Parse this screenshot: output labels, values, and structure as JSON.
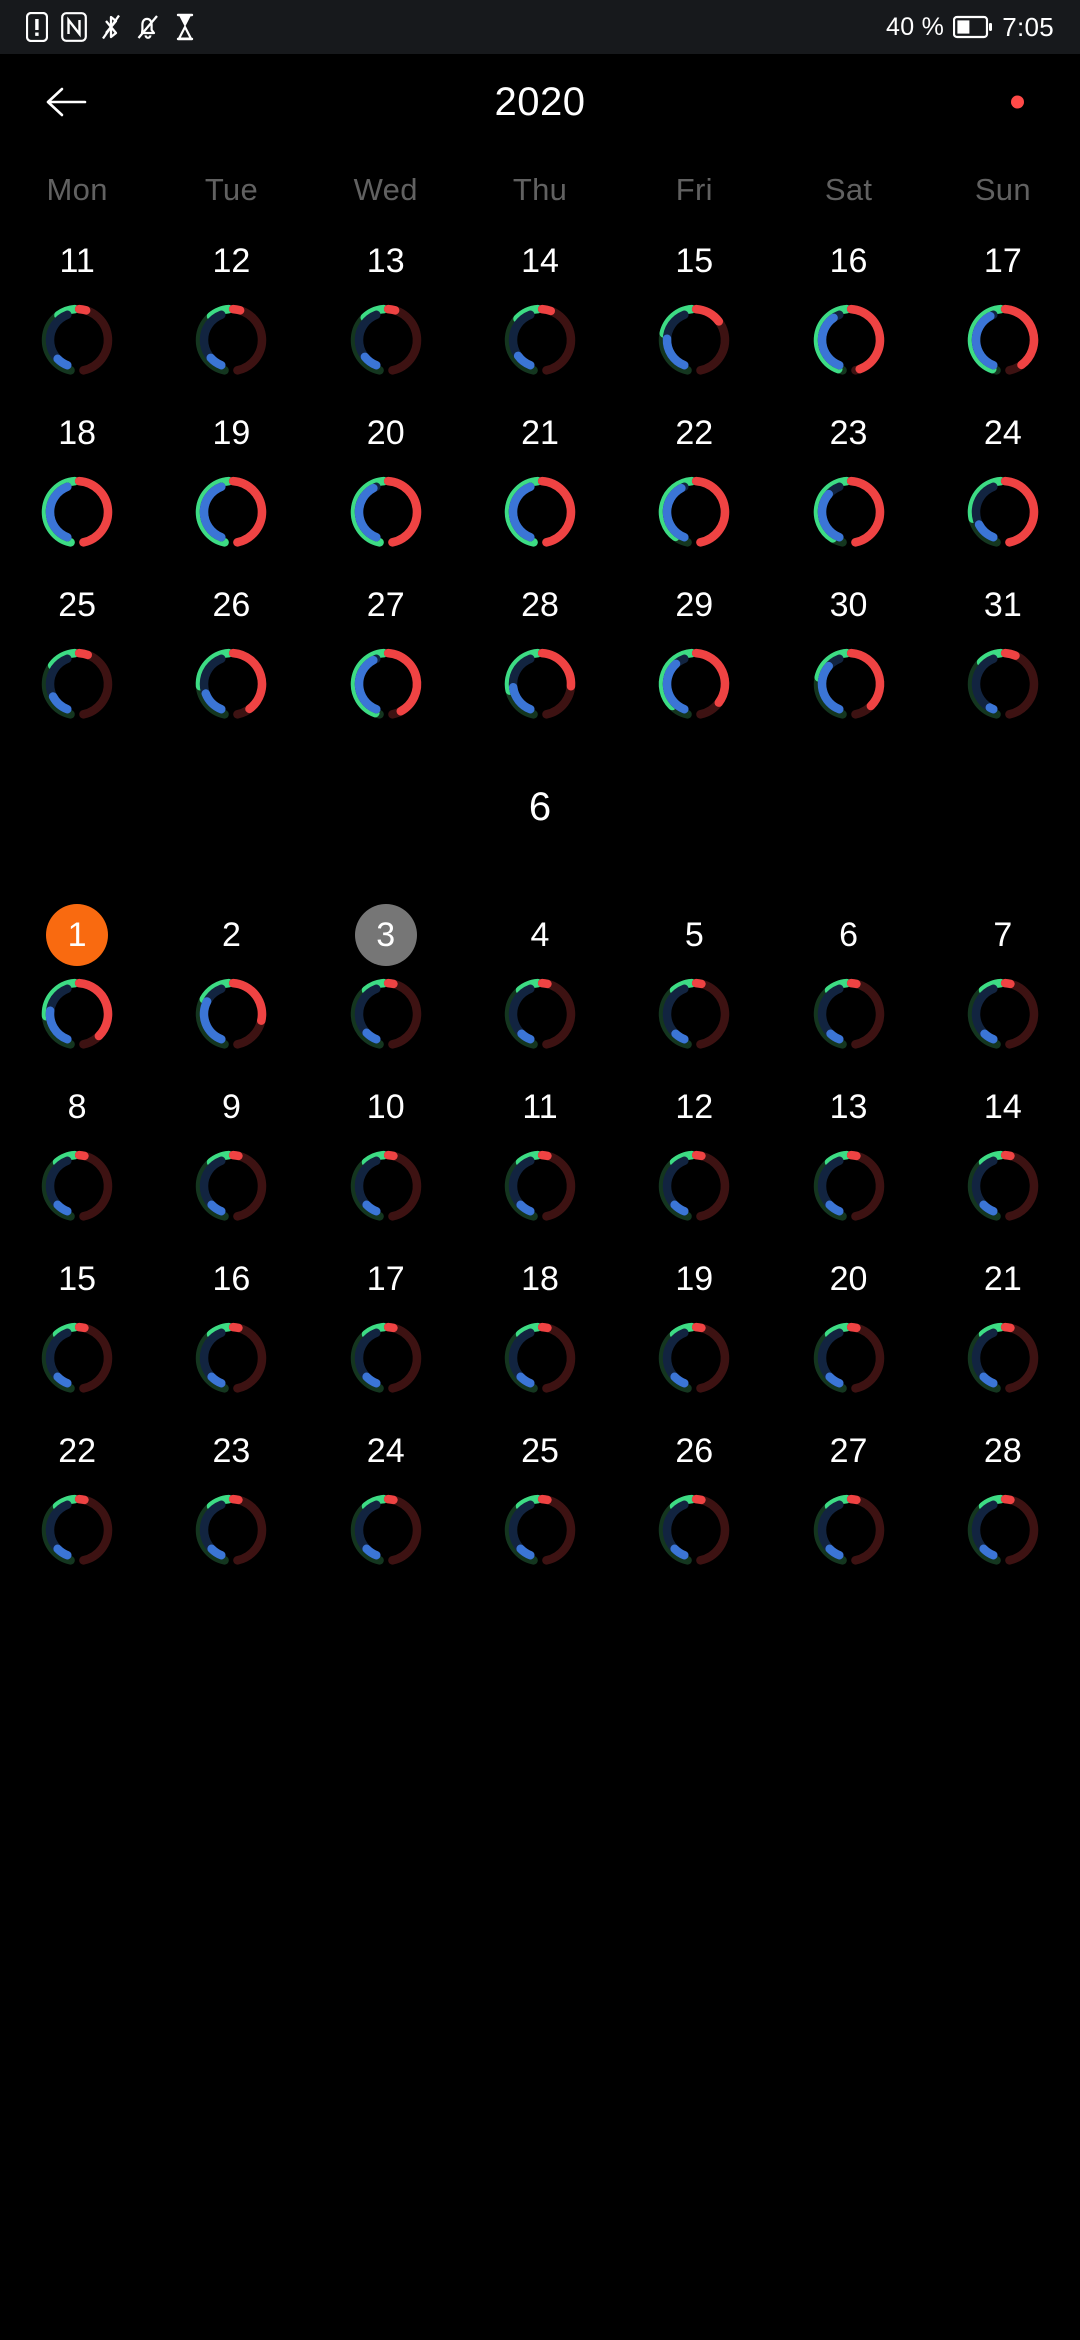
{
  "status_bar": {
    "icons": [
      "sim-alert-icon",
      "nfc-icon",
      "bluetooth-off-icon",
      "notifications-muted-icon",
      "hourglass-icon"
    ],
    "battery_percent": "40 %",
    "battery_icon": "battery-half-icon",
    "time": "7:05"
  },
  "app_bar": {
    "back_icon": "back-arrow-icon",
    "title": "2020",
    "indicator_icon": "red-dot-icon",
    "indicator_color": "#ff4a48"
  },
  "weekdays": [
    "Mon",
    "Tue",
    "Wed",
    "Thu",
    "Fri",
    "Sat",
    "Sun"
  ],
  "ring_colors": {
    "green_fill": "#3ddc84",
    "green_track": "#14361f",
    "red_fill": "#ef4343",
    "red_track": "#3d1212",
    "blue_fill": "#3b75d6",
    "blue_track": "#122440"
  },
  "highlight_colors": {
    "today": "#f96a10",
    "selected": "#767676"
  },
  "month_separator": "6",
  "weeks": [
    {
      "days": [
        {
          "label": "11",
          "green": 0.2,
          "red": 0.08,
          "blue": 0.18,
          "state": "none"
        },
        {
          "label": "12",
          "green": 0.22,
          "red": 0.08,
          "blue": 0.2,
          "state": "none"
        },
        {
          "label": "13",
          "green": 0.24,
          "red": 0.08,
          "blue": 0.22,
          "state": "none"
        },
        {
          "label": "14",
          "green": 0.26,
          "red": 0.1,
          "blue": 0.24,
          "state": "none"
        },
        {
          "label": "15",
          "green": 0.45,
          "red": 0.3,
          "blue": 0.52,
          "state": "none"
        },
        {
          "label": "16",
          "green": 0.95,
          "red": 0.95,
          "blue": 0.9,
          "state": "none"
        },
        {
          "label": "17",
          "green": 0.95,
          "red": 0.85,
          "blue": 0.95,
          "state": "none"
        }
      ]
    },
    {
      "days": [
        {
          "label": "18",
          "green": 1.0,
          "red": 1.0,
          "blue": 1.0,
          "state": "none"
        },
        {
          "label": "19",
          "green": 1.0,
          "red": 1.0,
          "blue": 1.0,
          "state": "none"
        },
        {
          "label": "20",
          "green": 1.0,
          "red": 1.0,
          "blue": 0.95,
          "state": "none"
        },
        {
          "label": "21",
          "green": 1.0,
          "red": 1.0,
          "blue": 1.0,
          "state": "none"
        },
        {
          "label": "22",
          "green": 0.85,
          "red": 1.0,
          "blue": 0.95,
          "state": "none"
        },
        {
          "label": "23",
          "green": 0.88,
          "red": 1.0,
          "blue": 0.8,
          "state": "none"
        },
        {
          "label": "24",
          "green": 0.6,
          "red": 1.0,
          "blue": 0.3,
          "state": "none"
        }
      ]
    },
    {
      "days": [
        {
          "label": "25",
          "green": 0.3,
          "red": 0.1,
          "blue": 0.3,
          "state": "none"
        },
        {
          "label": "26",
          "green": 0.55,
          "red": 0.85,
          "blue": 0.35,
          "state": "none"
        },
        {
          "label": "27",
          "green": 0.95,
          "red": 0.9,
          "blue": 0.95,
          "state": "none"
        },
        {
          "label": "28",
          "green": 0.6,
          "red": 0.55,
          "blue": 0.45,
          "state": "none"
        },
        {
          "label": "29",
          "green": 0.8,
          "red": 0.75,
          "blue": 0.85,
          "state": "none"
        },
        {
          "label": "30",
          "green": 0.45,
          "red": 0.8,
          "blue": 0.8,
          "state": "none"
        },
        {
          "label": "31",
          "green": 0.25,
          "red": 0.12,
          "blue": 0.05,
          "state": "none"
        }
      ]
    }
  ],
  "weeks2": [
    {
      "days": [
        {
          "label": "1",
          "green": 0.55,
          "red": 0.8,
          "blue": 0.55,
          "state": "today"
        },
        {
          "label": "2",
          "green": 0.35,
          "red": 0.6,
          "blue": 0.7,
          "state": "none"
        },
        {
          "label": "3",
          "green": 0.22,
          "red": 0.06,
          "blue": 0.18,
          "state": "selected"
        },
        {
          "label": "4",
          "green": 0.22,
          "red": 0.06,
          "blue": 0.16,
          "state": "none"
        },
        {
          "label": "5",
          "green": 0.22,
          "red": 0.06,
          "blue": 0.16,
          "state": "none"
        },
        {
          "label": "6",
          "green": 0.22,
          "red": 0.06,
          "blue": 0.16,
          "state": "none"
        },
        {
          "label": "7",
          "green": 0.22,
          "red": 0.06,
          "blue": 0.16,
          "state": "none"
        }
      ]
    },
    {
      "days": [
        {
          "label": "8",
          "green": 0.22,
          "red": 0.06,
          "blue": 0.18,
          "state": "none"
        },
        {
          "label": "9",
          "green": 0.22,
          "red": 0.06,
          "blue": 0.18,
          "state": "none"
        },
        {
          "label": "10",
          "green": 0.22,
          "red": 0.06,
          "blue": 0.18,
          "state": "none"
        },
        {
          "label": "11",
          "green": 0.22,
          "red": 0.06,
          "blue": 0.18,
          "state": "none"
        },
        {
          "label": "12",
          "green": 0.22,
          "red": 0.06,
          "blue": 0.18,
          "state": "none"
        },
        {
          "label": "13",
          "green": 0.22,
          "red": 0.06,
          "blue": 0.18,
          "state": "none"
        },
        {
          "label": "14",
          "green": 0.22,
          "red": 0.06,
          "blue": 0.18,
          "state": "none"
        }
      ]
    },
    {
      "days": [
        {
          "label": "15",
          "green": 0.22,
          "red": 0.06,
          "blue": 0.18,
          "state": "none"
        },
        {
          "label": "16",
          "green": 0.22,
          "red": 0.06,
          "blue": 0.18,
          "state": "none"
        },
        {
          "label": "17",
          "green": 0.22,
          "red": 0.06,
          "blue": 0.18,
          "state": "none"
        },
        {
          "label": "18",
          "green": 0.22,
          "red": 0.06,
          "blue": 0.18,
          "state": "none"
        },
        {
          "label": "19",
          "green": 0.22,
          "red": 0.06,
          "blue": 0.18,
          "state": "none"
        },
        {
          "label": "20",
          "green": 0.22,
          "red": 0.06,
          "blue": 0.18,
          "state": "none"
        },
        {
          "label": "21",
          "green": 0.22,
          "red": 0.06,
          "blue": 0.18,
          "state": "none"
        }
      ]
    },
    {
      "days": [
        {
          "label": "22",
          "green": 0.22,
          "red": 0.06,
          "blue": 0.18,
          "state": "none"
        },
        {
          "label": "23",
          "green": 0.22,
          "red": 0.06,
          "blue": 0.18,
          "state": "none"
        },
        {
          "label": "24",
          "green": 0.22,
          "red": 0.06,
          "blue": 0.18,
          "state": "none"
        },
        {
          "label": "25",
          "green": 0.22,
          "red": 0.06,
          "blue": 0.18,
          "state": "none"
        },
        {
          "label": "26",
          "green": 0.22,
          "red": 0.06,
          "blue": 0.18,
          "state": "none"
        },
        {
          "label": "27",
          "green": 0.22,
          "red": 0.06,
          "blue": 0.18,
          "state": "none"
        },
        {
          "label": "28",
          "green": 0.22,
          "red": 0.06,
          "blue": 0.18,
          "state": "none"
        }
      ]
    }
  ]
}
